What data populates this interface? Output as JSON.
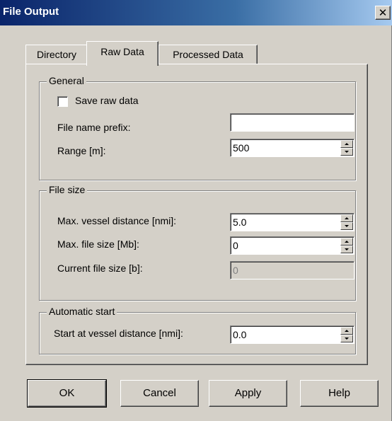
{
  "window": {
    "title": "File Output",
    "close_glyph": "✕"
  },
  "tabs": [
    {
      "label": "Directory",
      "active": false
    },
    {
      "label": "Raw Data",
      "active": true
    },
    {
      "label": "Processed Data",
      "active": false
    }
  ],
  "general": {
    "legend": "General",
    "save_raw_label": "Save raw data",
    "save_raw_checked": false,
    "prefix_label": "File name prefix:",
    "prefix_value": "",
    "range_label": "Range [m]:",
    "range_value": "500"
  },
  "file_size": {
    "legend": "File size",
    "vessel_distance_label": "Max. vessel distance [nmi]:",
    "vessel_distance_value": "5.0",
    "max_file_size_label": "Max. file size [Mb]:",
    "max_file_size_value": "0",
    "current_file_size_label": "Current file size [b]:",
    "current_file_size_value": "0"
  },
  "automatic_start": {
    "legend": "Automatic start",
    "start_distance_label": "Start at vessel distance [nmi]:",
    "start_distance_value": "0.0"
  },
  "buttons": {
    "ok": "OK",
    "cancel": "Cancel",
    "apply": "Apply",
    "help": "Help"
  }
}
